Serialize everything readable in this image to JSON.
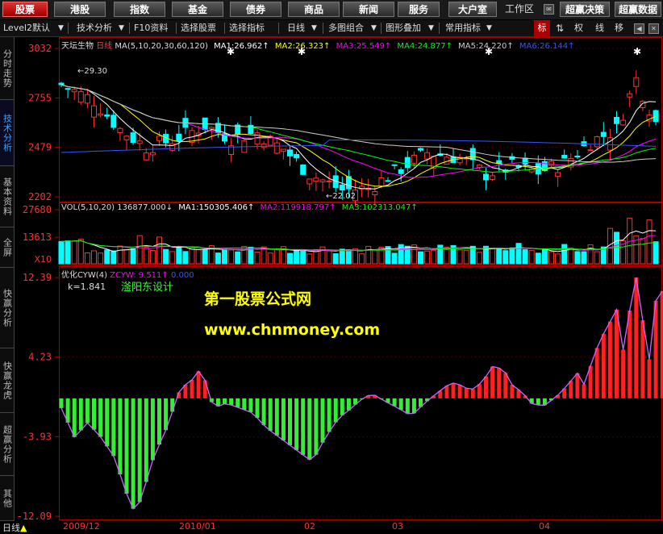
{
  "toolbar": {
    "buttons": [
      "股票",
      "港股",
      "指数",
      "基金",
      "债券",
      "商品",
      "新闻",
      "服务",
      "大户室"
    ],
    "workspace": "工作区",
    "right_buttons": [
      "超赢决策",
      "超赢数据"
    ]
  },
  "menu": {
    "items": [
      "Level2默认",
      "技术分析",
      "F10资料",
      "选择股票",
      "选择指标",
      "日线",
      "多图组合",
      "图形叠加",
      "常用指标"
    ],
    "right_tabs": [
      "标",
      "权",
      "线",
      "移"
    ]
  },
  "sidebar": [
    "分时走势",
    "技术分析",
    "基本资料",
    "全屏",
    "快赢分析",
    "快赢龙虎",
    "超赢分析",
    "其他"
  ],
  "price_panel": {
    "stock_name": "天坛生物",
    "period": "日线",
    "ma_params": "MA(5,10,20,30,60,120)",
    "ma_values": [
      {
        "label": "MA1:",
        "value": "26.962↑",
        "color": "#ffffff"
      },
      {
        "label": "MA2:",
        "value": "26.323↑",
        "color": "#ffff00"
      },
      {
        "label": "MA3:",
        "value": "25.549↑",
        "color": "#ff00ff"
      },
      {
        "label": "MA4:",
        "value": "24.877↑",
        "color": "#00ff00"
      },
      {
        "label": "MA5:",
        "value": "24.220↑",
        "color": "#cccccc"
      },
      {
        "label": "MA6:",
        "value": "26.144↑",
        "color": "#3355ff"
      }
    ],
    "y_ticks": [
      "3032",
      "2755",
      "2479",
      "2202"
    ],
    "annotation_high": "29.30",
    "annotation_low": "22.02"
  },
  "volume_panel": {
    "params": "VOL(5,10,20)",
    "value": "136877.000↓",
    "ma_values": [
      {
        "label": "MA1:",
        "value": "150305.406↑",
        "color": "#ffffff"
      },
      {
        "label": "MA2:",
        "value": "119918.797↑",
        "color": "#ff00ff"
      },
      {
        "label": "MA3:",
        "value": "102313.047↑",
        "color": "#00ff00"
      }
    ],
    "y_ticks": [
      "27680",
      "13613",
      "X10"
    ]
  },
  "indicator_panel": {
    "name": "优化CYW(4)",
    "zcyw_label": "ZCYW:",
    "zcyw_value": "9.511↑",
    "zero_value": "0.000",
    "k_text": "k=1.841",
    "author": "滏阳东设计",
    "y_ticks": [
      "12.39",
      "4.23",
      "-3.93",
      "-12.09"
    ]
  },
  "watermark": {
    "line1": "第一股票公式网",
    "line2": "www.chnmoney.com"
  },
  "xaxis": {
    "period_label": "日线",
    "labels": [
      "2009/12",
      "2010/01",
      "02",
      "03",
      "04"
    ]
  },
  "colors": {
    "up": "#ff3030",
    "down": "#00ffff",
    "cyw_pos": "#ff2020",
    "cyw_neg": "#33ee33",
    "cyw_line": "#cc66ff",
    "axis": "#aa0000"
  }
}
